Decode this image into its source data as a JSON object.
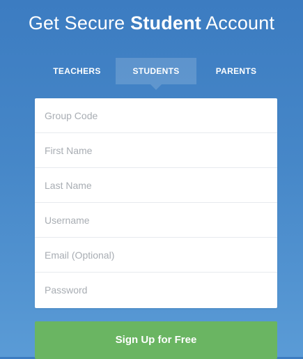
{
  "header": {
    "title_before": "Get Secure ",
    "title_strong": "Student",
    "title_after": " Account"
  },
  "tabs": {
    "teachers": "TEACHERS",
    "students": "STUDENTS",
    "parents": "PARENTS",
    "active": "STUDENTS"
  },
  "form": {
    "group_code": {
      "placeholder": "Group Code",
      "value": ""
    },
    "first_name": {
      "placeholder": "First Name",
      "value": ""
    },
    "last_name": {
      "placeholder": "Last Name",
      "value": ""
    },
    "username": {
      "placeholder": "Username",
      "value": ""
    },
    "email": {
      "placeholder": "Email (Optional)",
      "value": ""
    },
    "password": {
      "placeholder": "Password",
      "value": ""
    }
  },
  "actions": {
    "signup_label": "Sign Up for Free"
  },
  "colors": {
    "background_top": "#3c7cc1",
    "background_bottom": "#5a9bd6",
    "signup_green": "#6ab562",
    "field_divider": "#e7eaee"
  }
}
